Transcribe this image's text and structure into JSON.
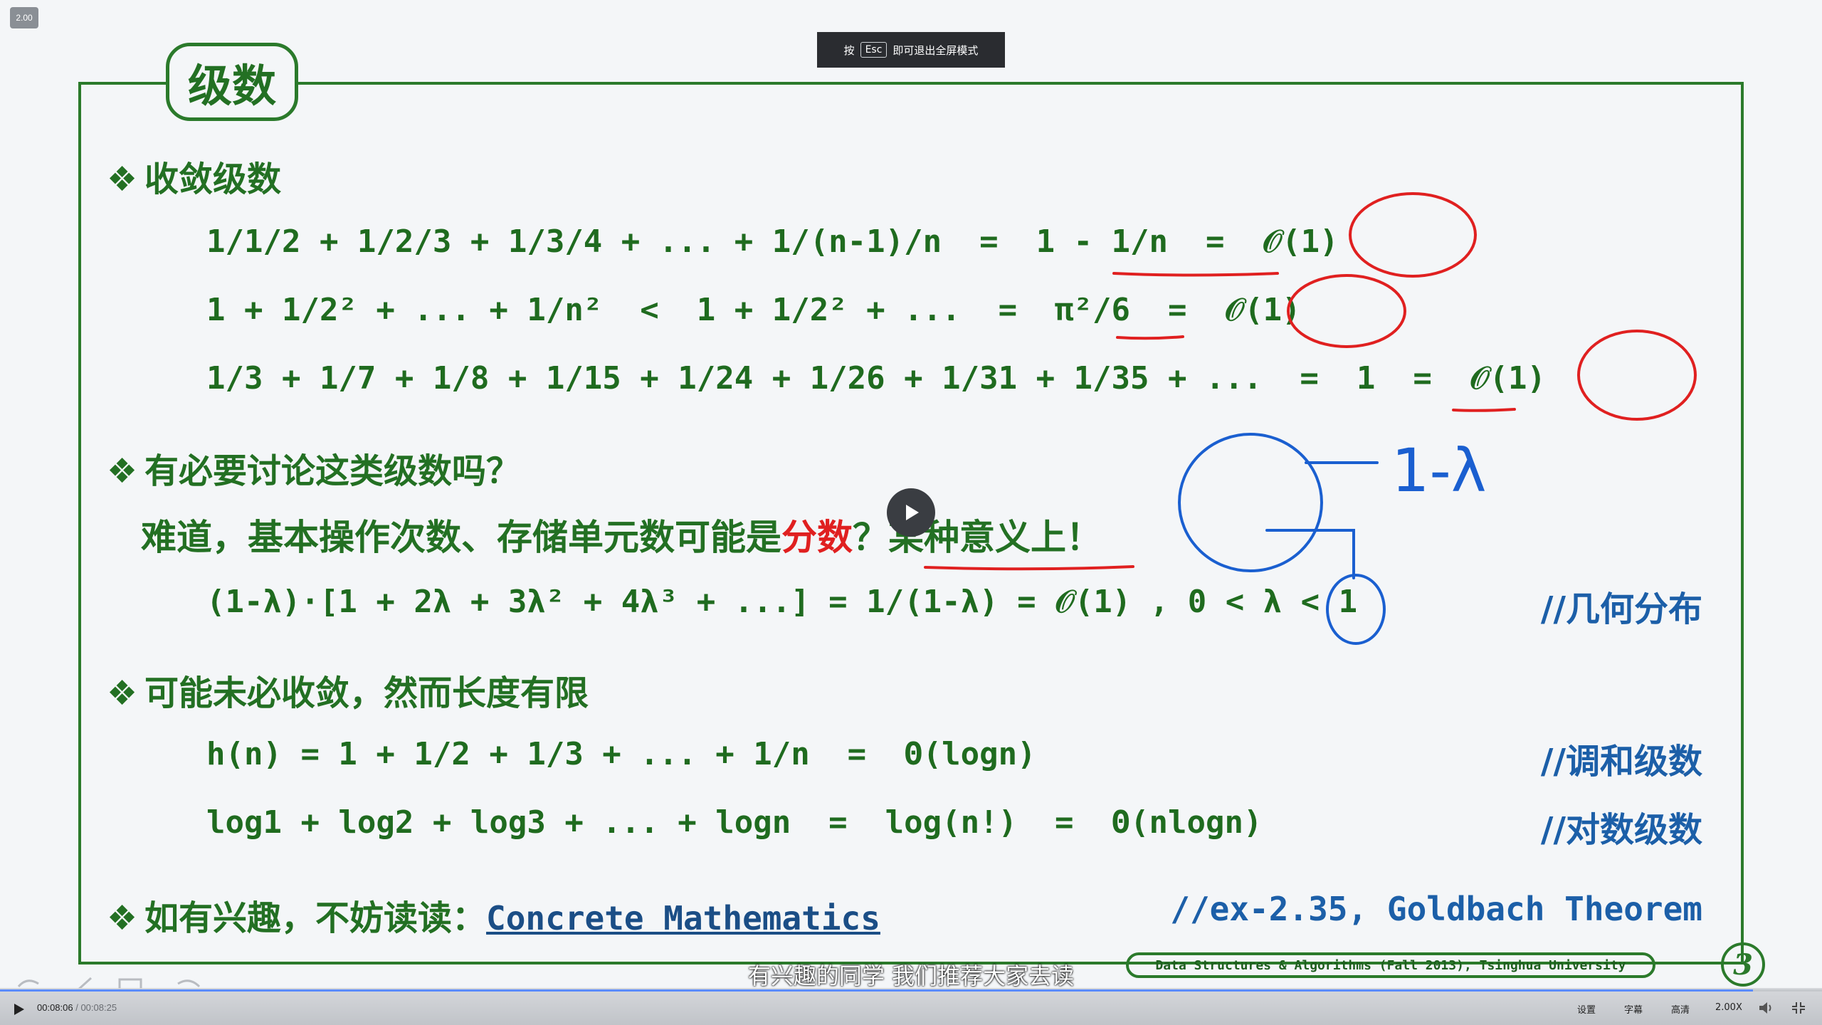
{
  "player": {
    "speed_badge": "2.00",
    "esc_hint_prefix": "按",
    "esc_key": "Esc",
    "esc_hint_suffix": "即可退出全屏模式",
    "subtitle": "有兴趣的同学 我们推荐大家去读",
    "current_time": "00:08:06",
    "separator": " / ",
    "duration": "00:08:25",
    "progress": 0.962,
    "controls": {
      "settings": "设置",
      "captions": "字幕",
      "quality": "高清",
      "speed": "2.00X"
    }
  },
  "slide": {
    "title": "级数",
    "section1": "收敛级数",
    "eq1_lhs": "1/1/2 + 1/2/3 + 1/3/4 + ... + 1/(n-1)/n  =  1 - 1/n  =  𝒪(1)",
    "eq2": "1 + 1/2² + ... + 1/n²  <  1 + 1/2² + ...  =  π²/6  =  𝒪(1)",
    "eq3": "1/3 + 1/7 + 1/8 + 1/15 + 1/24 + 1/26 + 1/31 + 1/35 + ...  =  1  =  𝒪(1)",
    "section2": "有必要讨论这类级数吗？",
    "question_pre": "难道，基本操作次数、存储单元数可能是",
    "question_red": "分数",
    "question_post": "？某种意义上！",
    "eq4": "(1-λ)·[1 + 2λ + 3λ² + 4λ³ + ...] = 1/(1-λ) = 𝒪(1) , 0 < λ < 1",
    "comment4": "//几何分布",
    "section3": "可能未必收敛，然而长度有限",
    "eq5": "h(n) = 1 + 1/2 + 1/3 + ... + 1/n  =  Θ(logn)",
    "comment5": "//调和级数",
    "eq6": "log1 + log2 + log3 + ... + logn  =  log(n!)  =  Θ(nlogn)",
    "comment6": "//对数级数",
    "section4": "如有兴趣，不妨读读：",
    "book": "Concrete Mathematics",
    "comment7": "//ex-2.35, Goldbach Theorem",
    "footer": "Data Structures & Algorithms (Fall 2013), Tsinghua University",
    "slide_number": "3",
    "handwritten_note": "1-λ"
  },
  "colors": {
    "frame_green": "#2b7a2b",
    "text_green": "#237023",
    "comment_blue": "#1c5fa8",
    "ink_red": "#e02020",
    "ink_blue": "#1a5fd0"
  }
}
